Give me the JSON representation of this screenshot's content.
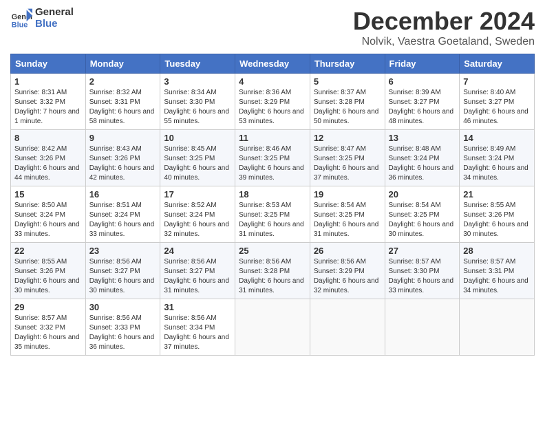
{
  "logo": {
    "line1": "General",
    "line2": "Blue"
  },
  "title": "December 2024",
  "subtitle": "Nolvik, Vaestra Goetaland, Sweden",
  "weekdays": [
    "Sunday",
    "Monday",
    "Tuesday",
    "Wednesday",
    "Thursday",
    "Friday",
    "Saturday"
  ],
  "weeks": [
    [
      {
        "day": 1,
        "sunrise": "8:31 AM",
        "sunset": "3:32 PM",
        "daylight": "7 hours and 1 minute."
      },
      {
        "day": 2,
        "sunrise": "8:32 AM",
        "sunset": "3:31 PM",
        "daylight": "6 hours and 58 minutes."
      },
      {
        "day": 3,
        "sunrise": "8:34 AM",
        "sunset": "3:30 PM",
        "daylight": "6 hours and 55 minutes."
      },
      {
        "day": 4,
        "sunrise": "8:36 AM",
        "sunset": "3:29 PM",
        "daylight": "6 hours and 53 minutes."
      },
      {
        "day": 5,
        "sunrise": "8:37 AM",
        "sunset": "3:28 PM",
        "daylight": "6 hours and 50 minutes."
      },
      {
        "day": 6,
        "sunrise": "8:39 AM",
        "sunset": "3:27 PM",
        "daylight": "6 hours and 48 minutes."
      },
      {
        "day": 7,
        "sunrise": "8:40 AM",
        "sunset": "3:27 PM",
        "daylight": "6 hours and 46 minutes."
      }
    ],
    [
      {
        "day": 8,
        "sunrise": "8:42 AM",
        "sunset": "3:26 PM",
        "daylight": "6 hours and 44 minutes."
      },
      {
        "day": 9,
        "sunrise": "8:43 AM",
        "sunset": "3:26 PM",
        "daylight": "6 hours and 42 minutes."
      },
      {
        "day": 10,
        "sunrise": "8:45 AM",
        "sunset": "3:25 PM",
        "daylight": "6 hours and 40 minutes."
      },
      {
        "day": 11,
        "sunrise": "8:46 AM",
        "sunset": "3:25 PM",
        "daylight": "6 hours and 39 minutes."
      },
      {
        "day": 12,
        "sunrise": "8:47 AM",
        "sunset": "3:25 PM",
        "daylight": "6 hours and 37 minutes."
      },
      {
        "day": 13,
        "sunrise": "8:48 AM",
        "sunset": "3:24 PM",
        "daylight": "6 hours and 36 minutes."
      },
      {
        "day": 14,
        "sunrise": "8:49 AM",
        "sunset": "3:24 PM",
        "daylight": "6 hours and 34 minutes."
      }
    ],
    [
      {
        "day": 15,
        "sunrise": "8:50 AM",
        "sunset": "3:24 PM",
        "daylight": "6 hours and 33 minutes."
      },
      {
        "day": 16,
        "sunrise": "8:51 AM",
        "sunset": "3:24 PM",
        "daylight": "6 hours and 33 minutes."
      },
      {
        "day": 17,
        "sunrise": "8:52 AM",
        "sunset": "3:24 PM",
        "daylight": "6 hours and 32 minutes."
      },
      {
        "day": 18,
        "sunrise": "8:53 AM",
        "sunset": "3:25 PM",
        "daylight": "6 hours and 31 minutes."
      },
      {
        "day": 19,
        "sunrise": "8:54 AM",
        "sunset": "3:25 PM",
        "daylight": "6 hours and 31 minutes."
      },
      {
        "day": 20,
        "sunrise": "8:54 AM",
        "sunset": "3:25 PM",
        "daylight": "6 hours and 30 minutes."
      },
      {
        "day": 21,
        "sunrise": "8:55 AM",
        "sunset": "3:26 PM",
        "daylight": "6 hours and 30 minutes."
      }
    ],
    [
      {
        "day": 22,
        "sunrise": "8:55 AM",
        "sunset": "3:26 PM",
        "daylight": "6 hours and 30 minutes."
      },
      {
        "day": 23,
        "sunrise": "8:56 AM",
        "sunset": "3:27 PM",
        "daylight": "6 hours and 30 minutes."
      },
      {
        "day": 24,
        "sunrise": "8:56 AM",
        "sunset": "3:27 PM",
        "daylight": "6 hours and 31 minutes."
      },
      {
        "day": 25,
        "sunrise": "8:56 AM",
        "sunset": "3:28 PM",
        "daylight": "6 hours and 31 minutes."
      },
      {
        "day": 26,
        "sunrise": "8:56 AM",
        "sunset": "3:29 PM",
        "daylight": "6 hours and 32 minutes."
      },
      {
        "day": 27,
        "sunrise": "8:57 AM",
        "sunset": "3:30 PM",
        "daylight": "6 hours and 33 minutes."
      },
      {
        "day": 28,
        "sunrise": "8:57 AM",
        "sunset": "3:31 PM",
        "daylight": "6 hours and 34 minutes."
      }
    ],
    [
      {
        "day": 29,
        "sunrise": "8:57 AM",
        "sunset": "3:32 PM",
        "daylight": "6 hours and 35 minutes."
      },
      {
        "day": 30,
        "sunrise": "8:56 AM",
        "sunset": "3:33 PM",
        "daylight": "6 hours and 36 minutes."
      },
      {
        "day": 31,
        "sunrise": "8:56 AM",
        "sunset": "3:34 PM",
        "daylight": "6 hours and 37 minutes."
      },
      null,
      null,
      null,
      null
    ]
  ],
  "labels": {
    "sunrise": "Sunrise:",
    "sunset": "Sunset:",
    "daylight": "Daylight:"
  }
}
